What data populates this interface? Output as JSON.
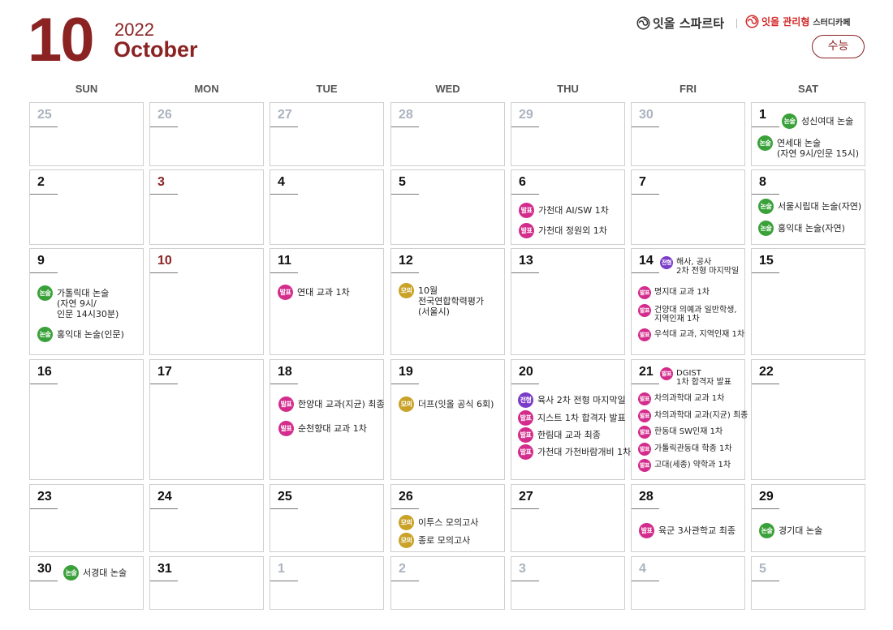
{
  "header": {
    "month_number": "10",
    "year": "2022",
    "month_name": "October",
    "brand_primary": "잇올 스파르타",
    "brand_secondary": "잇올 관리형",
    "brand_secondary_sub": "스터디카페",
    "suneung_label": "수능"
  },
  "colors": {
    "accent": "#8b2323",
    "essay_badge": "#3aa13a",
    "announce_badge": "#d42c8c",
    "mock_badge": "#c9a227",
    "type_badge": "#7a3cc9"
  },
  "weekdays": [
    "SUN",
    "MON",
    "TUE",
    "WED",
    "THU",
    "FRI",
    "SAT"
  ],
  "weeks": [
    [
      {
        "day": "25",
        "style": "dim",
        "events": []
      },
      {
        "day": "26",
        "style": "dim",
        "events": []
      },
      {
        "day": "27",
        "style": "dim",
        "events": []
      },
      {
        "day": "28",
        "style": "dim",
        "events": []
      },
      {
        "day": "29",
        "style": "dim",
        "events": []
      },
      {
        "day": "30",
        "style": "dim",
        "events": []
      },
      {
        "day": "1",
        "style": "normal",
        "events": [
          {
            "badge": "논술",
            "kind": "essay",
            "text": "성신여대 논술"
          },
          {
            "badge": "논술",
            "kind": "essay",
            "text": "연세대 논술\n(자연 9시/인문 15시)"
          }
        ]
      }
    ],
    [
      {
        "day": "2",
        "style": "normal",
        "events": []
      },
      {
        "day": "3",
        "style": "red",
        "events": []
      },
      {
        "day": "4",
        "style": "normal",
        "events": []
      },
      {
        "day": "5",
        "style": "normal",
        "events": []
      },
      {
        "day": "6",
        "style": "normal",
        "events": [
          {
            "badge": "발표",
            "kind": "announce",
            "text": "가천대 AI/SW 1차"
          },
          {
            "badge": "발표",
            "kind": "announce",
            "text": "가천대 정원외 1차"
          }
        ]
      },
      {
        "day": "7",
        "style": "normal",
        "events": []
      },
      {
        "day": "8",
        "style": "normal",
        "events": [
          {
            "badge": "논술",
            "kind": "essay",
            "text": "서울시립대 논술(자연)"
          },
          {
            "badge": "논술",
            "kind": "essay",
            "text": "홍익대 논술(자연)"
          }
        ]
      }
    ],
    [
      {
        "day": "9",
        "style": "normal",
        "events": [
          {
            "badge": "논술",
            "kind": "essay",
            "text": "가톨릭대 논술\n(자연 9시/\n인문 14시30분)"
          },
          {
            "badge": "논술",
            "kind": "essay",
            "text": "홍익대 논술(인문)"
          }
        ]
      },
      {
        "day": "10",
        "style": "red",
        "events": []
      },
      {
        "day": "11",
        "style": "normal",
        "events": [
          {
            "badge": "발표",
            "kind": "announce",
            "text": "연대 교과 1차"
          }
        ]
      },
      {
        "day": "12",
        "style": "normal",
        "events": [
          {
            "badge": "모의",
            "kind": "mock",
            "text": "10월\n전국연합학력평가\n(서울시)"
          }
        ]
      },
      {
        "day": "13",
        "style": "normal",
        "events": []
      },
      {
        "day": "14",
        "style": "normal",
        "events": [
          {
            "badge": "전형",
            "kind": "type",
            "text": "해사, 공사\n2차 전형 마지막일"
          },
          {
            "badge": "발표",
            "kind": "announce",
            "text": "명지대 교과 1차"
          },
          {
            "badge": "발표",
            "kind": "announce",
            "text": "건양대 의예과 일반학생,\n지역인재 1차"
          },
          {
            "badge": "발표",
            "kind": "announce",
            "text": "우석대 교과, 지역인재 1차"
          }
        ]
      },
      {
        "day": "15",
        "style": "normal",
        "events": []
      }
    ],
    [
      {
        "day": "16",
        "style": "normal",
        "events": []
      },
      {
        "day": "17",
        "style": "normal",
        "events": []
      },
      {
        "day": "18",
        "style": "normal",
        "events": [
          {
            "badge": "발표",
            "kind": "announce",
            "text": "한양대 교과(지균) 최종"
          },
          {
            "badge": "발표",
            "kind": "announce",
            "text": "순천향대 교과 1차"
          }
        ]
      },
      {
        "day": "19",
        "style": "normal",
        "events": [
          {
            "badge": "모의",
            "kind": "mock",
            "text": "더프(잇올 공식 6회)"
          }
        ]
      },
      {
        "day": "20",
        "style": "normal",
        "events": [
          {
            "badge": "전형",
            "kind": "type",
            "text": "육사 2차 전형 마지막일"
          },
          {
            "badge": "발표",
            "kind": "announce",
            "text": "지스트 1차 합격자 발표"
          },
          {
            "badge": "발표",
            "kind": "announce",
            "text": "한림대 교과 최종"
          },
          {
            "badge": "발표",
            "kind": "announce",
            "text": "가천대 가천바람개비 1차"
          }
        ]
      },
      {
        "day": "21",
        "style": "normal",
        "events": [
          {
            "badge": "발표",
            "kind": "announce",
            "text": "DGIST\n1차 합격자 발표"
          },
          {
            "badge": "발표",
            "kind": "announce",
            "text": "차의과학대 교과 1차"
          },
          {
            "badge": "발표",
            "kind": "announce",
            "text": "차의과학대 교과(지균) 최종"
          },
          {
            "badge": "발표",
            "kind": "announce",
            "text": "한동대 SW인재 1차"
          },
          {
            "badge": "발표",
            "kind": "announce",
            "text": "가톨릭관동대 학종 1차"
          },
          {
            "badge": "발표",
            "kind": "announce",
            "text": "고대(세종) 약학과 1차"
          }
        ]
      },
      {
        "day": "22",
        "style": "normal",
        "events": []
      }
    ],
    [
      {
        "day": "23",
        "style": "normal",
        "events": []
      },
      {
        "day": "24",
        "style": "normal",
        "events": []
      },
      {
        "day": "25",
        "style": "normal",
        "events": []
      },
      {
        "day": "26",
        "style": "normal",
        "events": [
          {
            "badge": "모의",
            "kind": "mock",
            "text": "이투스 모의고사"
          },
          {
            "badge": "모의",
            "kind": "mock",
            "text": "종로 모의고사"
          }
        ]
      },
      {
        "day": "27",
        "style": "normal",
        "events": []
      },
      {
        "day": "28",
        "style": "normal",
        "events": [
          {
            "badge": "발표",
            "kind": "announce",
            "text": "육군 3사관학교 최종"
          }
        ]
      },
      {
        "day": "29",
        "style": "normal",
        "events": [
          {
            "badge": "논술",
            "kind": "essay",
            "text": "경기대 논술"
          }
        ]
      }
    ],
    [
      {
        "day": "30",
        "style": "normal",
        "events": [
          {
            "badge": "논술",
            "kind": "essay",
            "text": "서경대 논술"
          }
        ]
      },
      {
        "day": "31",
        "style": "normal",
        "events": []
      },
      {
        "day": "1",
        "style": "dim",
        "events": []
      },
      {
        "day": "2",
        "style": "dim",
        "events": []
      },
      {
        "day": "3",
        "style": "dim",
        "events": []
      },
      {
        "day": "4",
        "style": "dim",
        "events": []
      },
      {
        "day": "5",
        "style": "dim",
        "events": []
      }
    ]
  ]
}
